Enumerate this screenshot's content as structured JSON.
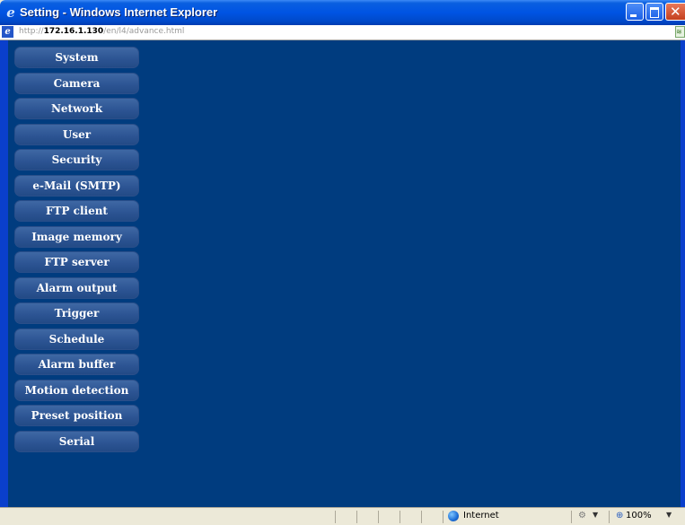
{
  "window": {
    "title": "Setting - Windows Internet Explorer"
  },
  "address": {
    "url_prefix": "http://",
    "url_host": "172.16.1.130",
    "url_path": "/en/l4/advance.html"
  },
  "colors": {
    "content_bg": "#003c7f",
    "nav_button": "#2d5594",
    "titlebar": "#0054e3"
  },
  "icons": {
    "title": "ie-logo-icon",
    "address": "ie-page-icon",
    "rss": "feed-icon",
    "zone": "globe-icon",
    "zoom": "zoom-icon"
  },
  "nav": {
    "items": [
      {
        "label": "System"
      },
      {
        "label": "Camera"
      },
      {
        "label": "Network"
      },
      {
        "label": "User"
      },
      {
        "label": "Security"
      },
      {
        "label": "e-Mail (SMTP)"
      },
      {
        "label": "FTP client"
      },
      {
        "label": "Image memory"
      },
      {
        "label": "FTP server"
      },
      {
        "label": "Alarm output"
      },
      {
        "label": "Trigger"
      },
      {
        "label": "Schedule"
      },
      {
        "label": "Alarm buffer"
      },
      {
        "label": "Motion detection"
      },
      {
        "label": "Preset position"
      },
      {
        "label": "Serial"
      }
    ]
  },
  "status": {
    "zone": "Internet",
    "zoom": "100%"
  }
}
